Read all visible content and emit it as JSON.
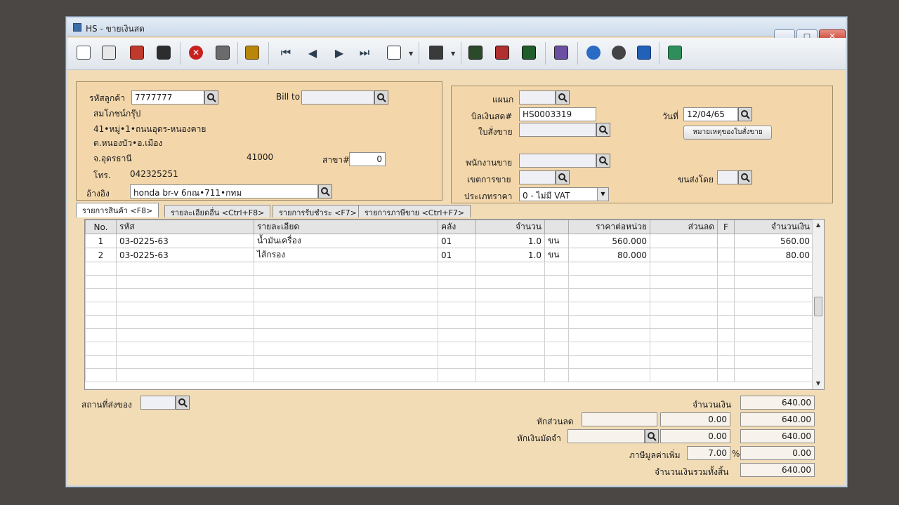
{
  "window": {
    "title": "HS - ขายเงินสด"
  },
  "customer": {
    "code_label": "รหัสลูกค้า",
    "code": "7777777",
    "name": "สมโภชน์กรุ๊ป",
    "address1": "41•หมู่•1•ถนนอุดร-หนองคาย",
    "address2": "ต.หนองบัว•อ.เมือง",
    "province": "จ.อุดรธานี",
    "postcode": "41000",
    "phone_label": "โทร.",
    "phone": "042325251",
    "bill_to_label": "Bill to",
    "bill_to": "",
    "branch_label": "สาขา#",
    "branch": "0",
    "ref_label": "อ้างอิง",
    "ref": "honda br-v 6กณ•711•กทม"
  },
  "document": {
    "dept_label": "แผนก",
    "dept": "",
    "bill_no_label": "บิลเงินสด#",
    "bill_no": "HS0003319",
    "date_label": "วันที่",
    "date": "12/04/65",
    "order_label": "ใบสั่งขาย",
    "order": "",
    "order_note_button": "หมายเหตุของใบสั่งขาย",
    "salesman_label": "พนักงานขาย",
    "salesman": "",
    "area_label": "เขตการขาย",
    "area": "",
    "ship_by_label": "ขนส่งโดย",
    "ship_by": "",
    "price_type_label": "ประเภทราคา",
    "price_type": "0 - ไม่มี VAT"
  },
  "tabs": [
    {
      "label": "รายการสินค้า <F8>"
    },
    {
      "label": "รายละเอียดอื่น <Ctrl+F8>"
    },
    {
      "label": "รายการรับชำระ <F7>"
    },
    {
      "label": "รายการภาษีขาย <Ctrl+F7>"
    }
  ],
  "grid": {
    "headers": [
      "No.",
      "รหัส",
      "รายละเอียด",
      "คลัง",
      "จำนวน",
      "",
      "ราคาต่อหน่วย",
      "ส่วนลด",
      "F",
      "จำนวนเงิน"
    ],
    "rows": [
      [
        "1",
        "03-0225-63",
        "น้ำมันเครื่อง",
        "01",
        "1.0",
        "ขน",
        "560.000",
        "",
        "",
        "560.00"
      ],
      [
        "2",
        "03-0225-63",
        "ไส้กรอง",
        "01",
        "1.0",
        "ขน",
        "80.000",
        "",
        "",
        "80.00"
      ]
    ]
  },
  "footer": {
    "ship_place_label": "สถานที่ส่งของ",
    "ship_place": "",
    "amount_label": "จำนวนเงิน",
    "amount": "640.00",
    "discount_label": "หักส่วนลด",
    "discount_text": "",
    "discount_value": "0.00",
    "after_discount": "640.00",
    "deposit_label": "หักเงินมัดจำ",
    "deposit_text": "",
    "deposit_value": "0.00",
    "after_deposit": "640.00",
    "vat_label": "ภาษีมูลค่าเพิ่ม",
    "vat_rate": "7.00",
    "vat_percent": "%",
    "vat_value": "0.00",
    "total_label": "จำนวนเงินรวมทั้งสิ้น",
    "total": "640.00"
  },
  "toolbar_icons": [
    "new-icon",
    "edit-icon",
    "delete-icon",
    "trash-icon",
    "cancel-icon",
    "save-icon",
    "approve-icon",
    "first-icon",
    "prev-icon",
    "next-icon",
    "last-icon",
    "search-icon",
    "print-icon",
    "report-icon",
    "report2-icon",
    "chart-icon",
    "calendar-icon",
    "dc-icon",
    "ck-icon",
    "ok-icon",
    "exit-icon"
  ]
}
